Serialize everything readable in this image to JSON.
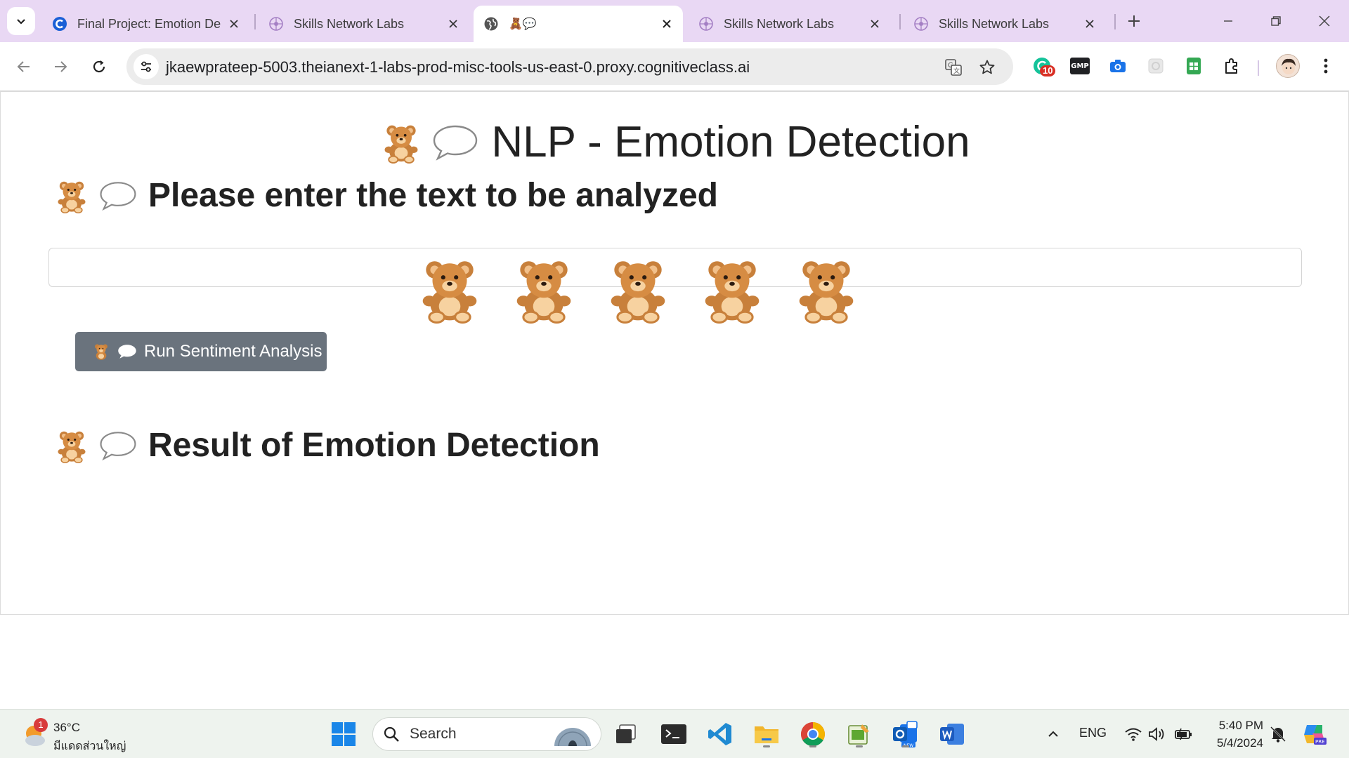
{
  "browser": {
    "tabs": [
      {
        "title": "Final Project: Emotion De",
        "icon": "coursera-icon",
        "active": false
      },
      {
        "title": "Skills Network Labs",
        "icon": "skills-network-icon",
        "active": false
      },
      {
        "title": "🧸💬",
        "icon": "globe-icon",
        "active": true
      },
      {
        "title": "Skills Network Labs",
        "icon": "skills-network-icon",
        "active": false
      },
      {
        "title": "Skills Network Labs",
        "icon": "skills-network-icon",
        "active": false
      }
    ],
    "url": "jkaewprateep-5003.theianext-1-labs-prod-misc-tools-us-east-0.proxy.cognitiveclass.ai",
    "extension_badge": "10",
    "gmp_label": "GMP"
  },
  "page": {
    "title": "NLP - Emotion Detection",
    "input_heading": "Please enter the text to be analyzed",
    "input_value": "🧸🧸🧸🧸🧸",
    "button_label": "Run Sentiment Analysis",
    "result_heading": "Result of Emotion Detection"
  },
  "taskbar": {
    "weather_temp": "36°C",
    "weather_desc": "มีแดดส่วนใหญ่",
    "weather_badge": "1",
    "search_label": "Search",
    "language": "ENG",
    "time": "5:40 PM",
    "date": "5/4/2024"
  },
  "colors": {
    "tab_strip": "#e9d8f4",
    "button": "#6a737d",
    "bear": "#c8803b"
  }
}
